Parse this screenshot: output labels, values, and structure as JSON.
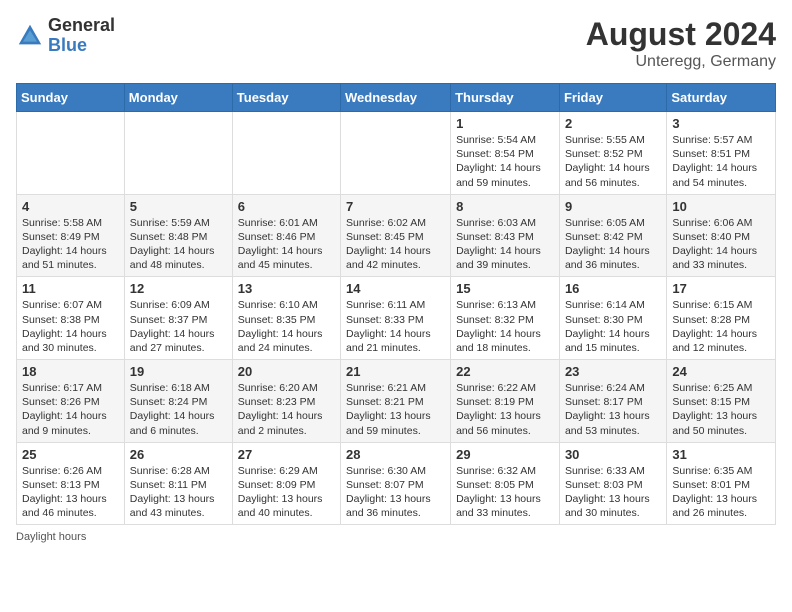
{
  "header": {
    "logo_general": "General",
    "logo_blue": "Blue",
    "month_year": "August 2024",
    "location": "Unteregg, Germany"
  },
  "footer": {
    "note": "Daylight hours"
  },
  "days_of_week": [
    "Sunday",
    "Monday",
    "Tuesday",
    "Wednesday",
    "Thursday",
    "Friday",
    "Saturday"
  ],
  "weeks": [
    [
      {
        "day": "",
        "info": ""
      },
      {
        "day": "",
        "info": ""
      },
      {
        "day": "",
        "info": ""
      },
      {
        "day": "",
        "info": ""
      },
      {
        "day": "1",
        "info": "Sunrise: 5:54 AM\nSunset: 8:54 PM\nDaylight: 14 hours\nand 59 minutes."
      },
      {
        "day": "2",
        "info": "Sunrise: 5:55 AM\nSunset: 8:52 PM\nDaylight: 14 hours\nand 56 minutes."
      },
      {
        "day": "3",
        "info": "Sunrise: 5:57 AM\nSunset: 8:51 PM\nDaylight: 14 hours\nand 54 minutes."
      }
    ],
    [
      {
        "day": "4",
        "info": "Sunrise: 5:58 AM\nSunset: 8:49 PM\nDaylight: 14 hours\nand 51 minutes."
      },
      {
        "day": "5",
        "info": "Sunrise: 5:59 AM\nSunset: 8:48 PM\nDaylight: 14 hours\nand 48 minutes."
      },
      {
        "day": "6",
        "info": "Sunrise: 6:01 AM\nSunset: 8:46 PM\nDaylight: 14 hours\nand 45 minutes."
      },
      {
        "day": "7",
        "info": "Sunrise: 6:02 AM\nSunset: 8:45 PM\nDaylight: 14 hours\nand 42 minutes."
      },
      {
        "day": "8",
        "info": "Sunrise: 6:03 AM\nSunset: 8:43 PM\nDaylight: 14 hours\nand 39 minutes."
      },
      {
        "day": "9",
        "info": "Sunrise: 6:05 AM\nSunset: 8:42 PM\nDaylight: 14 hours\nand 36 minutes."
      },
      {
        "day": "10",
        "info": "Sunrise: 6:06 AM\nSunset: 8:40 PM\nDaylight: 14 hours\nand 33 minutes."
      }
    ],
    [
      {
        "day": "11",
        "info": "Sunrise: 6:07 AM\nSunset: 8:38 PM\nDaylight: 14 hours\nand 30 minutes."
      },
      {
        "day": "12",
        "info": "Sunrise: 6:09 AM\nSunset: 8:37 PM\nDaylight: 14 hours\nand 27 minutes."
      },
      {
        "day": "13",
        "info": "Sunrise: 6:10 AM\nSunset: 8:35 PM\nDaylight: 14 hours\nand 24 minutes."
      },
      {
        "day": "14",
        "info": "Sunrise: 6:11 AM\nSunset: 8:33 PM\nDaylight: 14 hours\nand 21 minutes."
      },
      {
        "day": "15",
        "info": "Sunrise: 6:13 AM\nSunset: 8:32 PM\nDaylight: 14 hours\nand 18 minutes."
      },
      {
        "day": "16",
        "info": "Sunrise: 6:14 AM\nSunset: 8:30 PM\nDaylight: 14 hours\nand 15 minutes."
      },
      {
        "day": "17",
        "info": "Sunrise: 6:15 AM\nSunset: 8:28 PM\nDaylight: 14 hours\nand 12 minutes."
      }
    ],
    [
      {
        "day": "18",
        "info": "Sunrise: 6:17 AM\nSunset: 8:26 PM\nDaylight: 14 hours\nand 9 minutes."
      },
      {
        "day": "19",
        "info": "Sunrise: 6:18 AM\nSunset: 8:24 PM\nDaylight: 14 hours\nand 6 minutes."
      },
      {
        "day": "20",
        "info": "Sunrise: 6:20 AM\nSunset: 8:23 PM\nDaylight: 14 hours\nand 2 minutes."
      },
      {
        "day": "21",
        "info": "Sunrise: 6:21 AM\nSunset: 8:21 PM\nDaylight: 13 hours\nand 59 minutes."
      },
      {
        "day": "22",
        "info": "Sunrise: 6:22 AM\nSunset: 8:19 PM\nDaylight: 13 hours\nand 56 minutes."
      },
      {
        "day": "23",
        "info": "Sunrise: 6:24 AM\nSunset: 8:17 PM\nDaylight: 13 hours\nand 53 minutes."
      },
      {
        "day": "24",
        "info": "Sunrise: 6:25 AM\nSunset: 8:15 PM\nDaylight: 13 hours\nand 50 minutes."
      }
    ],
    [
      {
        "day": "25",
        "info": "Sunrise: 6:26 AM\nSunset: 8:13 PM\nDaylight: 13 hours\nand 46 minutes."
      },
      {
        "day": "26",
        "info": "Sunrise: 6:28 AM\nSunset: 8:11 PM\nDaylight: 13 hours\nand 43 minutes."
      },
      {
        "day": "27",
        "info": "Sunrise: 6:29 AM\nSunset: 8:09 PM\nDaylight: 13 hours\nand 40 minutes."
      },
      {
        "day": "28",
        "info": "Sunrise: 6:30 AM\nSunset: 8:07 PM\nDaylight: 13 hours\nand 36 minutes."
      },
      {
        "day": "29",
        "info": "Sunrise: 6:32 AM\nSunset: 8:05 PM\nDaylight: 13 hours\nand 33 minutes."
      },
      {
        "day": "30",
        "info": "Sunrise: 6:33 AM\nSunset: 8:03 PM\nDaylight: 13 hours\nand 30 minutes."
      },
      {
        "day": "31",
        "info": "Sunrise: 6:35 AM\nSunset: 8:01 PM\nDaylight: 13 hours\nand 26 minutes."
      }
    ]
  ]
}
